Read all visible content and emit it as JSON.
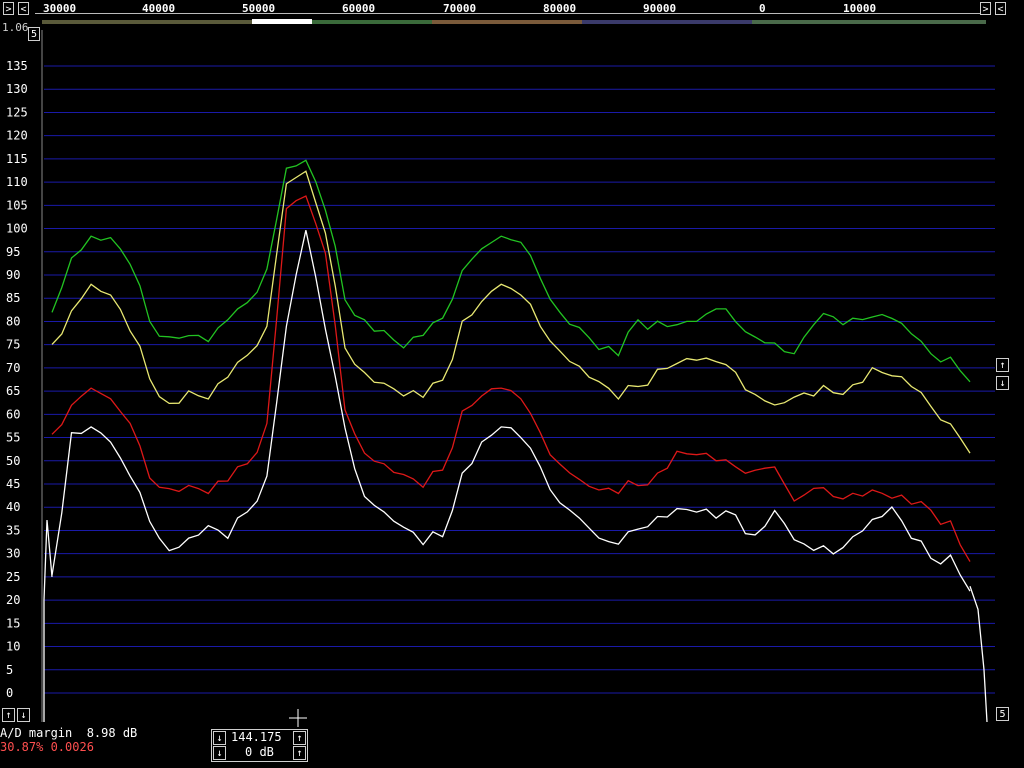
{
  "top_scale": {
    "scroll_left_label": "<",
    "scroll_right_label": ">",
    "ticks": [
      "30000",
      "40000",
      "50000",
      "60000",
      "70000",
      "80000",
      "90000",
      "0",
      "10000"
    ],
    "bar_label": "5",
    "top_small_text": "1.06"
  },
  "chart_data": {
    "type": "line",
    "title": "",
    "xlabel": "",
    "ylabel": "",
    "ylim": [
      0,
      135
    ],
    "ytick_labels": [
      "135",
      "130",
      "125",
      "120",
      "115",
      "110",
      "105",
      "100",
      "95",
      "90",
      "85",
      "80",
      "75",
      "70",
      "65",
      "60",
      "55",
      "50",
      "45",
      "40",
      "35",
      "30",
      "25",
      "20",
      "15",
      "10",
      "5",
      "0"
    ],
    "grid": true,
    "series": [
      {
        "color": "#22c322",
        "values": [
          83,
          94,
          98,
          97,
          93,
          80,
          76,
          78,
          76,
          80,
          83,
          92,
          113,
          114,
          105,
          85,
          80,
          77,
          75,
          77,
          80,
          92,
          96,
          98,
          96,
          90,
          82,
          78,
          75,
          73,
          80,
          79,
          80,
          80,
          82,
          81,
          77,
          75,
          72,
          80,
          81,
          80,
          82,
          81,
          77,
          72,
          73,
          67
        ]
      },
      {
        "color": "#e8e872",
        "values": [
          74,
          83,
          88,
          85,
          79,
          68,
          62,
          64,
          64,
          68,
          72,
          80,
          110,
          112,
          98,
          75,
          69,
          66,
          65,
          64,
          67,
          79,
          85,
          88,
          85,
          80,
          74,
          70,
          66,
          64,
          66,
          69,
          72,
          72,
          71,
          68,
          65,
          62,
          63,
          65,
          65,
          66,
          69,
          69,
          66,
          61,
          59,
          52
        ]
      },
      {
        "color": "#dd1818",
        "values": [
          55,
          63,
          66,
          63,
          57,
          47,
          44,
          44,
          44,
          46,
          49,
          57,
          105,
          107,
          94,
          62,
          52,
          49,
          46,
          45,
          48,
          60,
          65,
          66,
          63,
          55,
          50,
          46,
          43,
          44,
          45,
          47,
          51,
          52,
          50,
          48,
          49,
          49,
          41,
          43,
          43,
          43,
          43,
          43,
          41,
          39,
          36,
          29
        ]
      },
      {
        "color": "#ffffff",
        "values": [
          25,
          55,
          58,
          54,
          46,
          38,
          31,
          33,
          35,
          34,
          39,
          46,
          80,
          100,
          78,
          56,
          43,
          39,
          35,
          33,
          34,
          47,
          53,
          58,
          55,
          48,
          42,
          38,
          33,
          31,
          36,
          38,
          39,
          40,
          38,
          38,
          33,
          40,
          33,
          30,
          31,
          34,
          37,
          39,
          34,
          29,
          29,
          23
        ]
      }
    ]
  },
  "left_buttons": {
    "up": "↑",
    "down": "↓"
  },
  "right_buttons": {
    "up": "↑",
    "down": "↓",
    "bottom_label": "5"
  },
  "status": {
    "ad_margin": "A/D margin  8.98 dB",
    "percent": "30.87% 0.0026",
    "freq_value": "144.175",
    "gain_value": "0 dB",
    "up": "↑",
    "down": "↓"
  },
  "colors": {
    "grid": "#1a1aa8",
    "background": "#000000"
  }
}
